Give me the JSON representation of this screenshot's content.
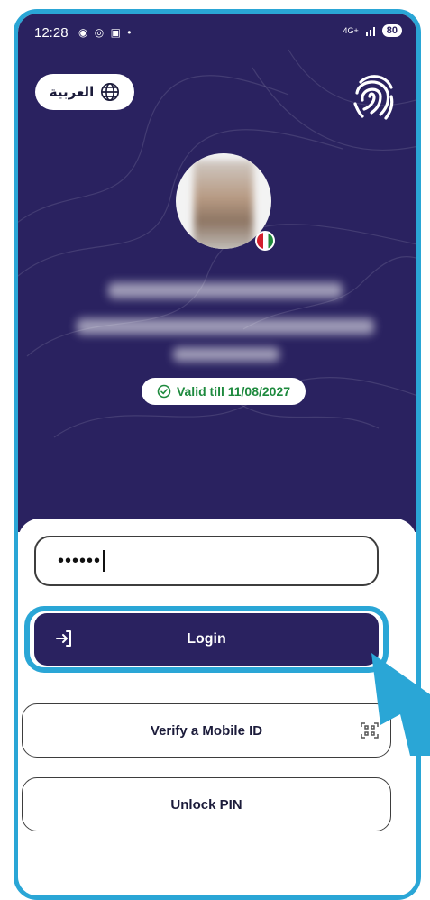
{
  "status_bar": {
    "time": "12:28",
    "left_icons": "◉ ◎ ▣ •",
    "network": "4G+",
    "battery": "80"
  },
  "header": {
    "language_button": "العربية",
    "language_icon": "globe-icon",
    "fingerprint_icon": "fingerprint-icon"
  },
  "profile": {
    "valid_text": "Valid till 11/08/2027",
    "valid_color": "#1e8a3e"
  },
  "login_form": {
    "pin_value": "••••••",
    "login_label": "Login",
    "login_icon": "login-arrow-icon"
  },
  "actions": {
    "verify_label": "Verify a Mobile ID",
    "verify_icon": "qr-scan-icon",
    "unlock_label": "Unlock PIN"
  },
  "colors": {
    "header_bg": "#2a2260",
    "highlight": "#2aa6d6",
    "primary_button": "#2a2260"
  }
}
